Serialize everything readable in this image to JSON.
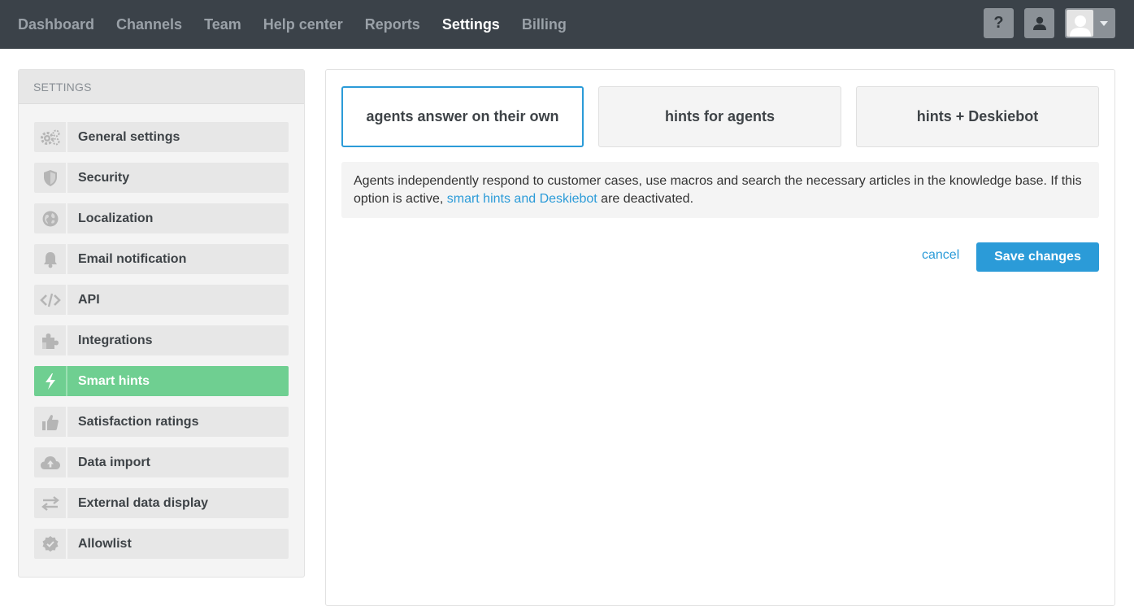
{
  "nav": {
    "items": [
      "Dashboard",
      "Channels",
      "Team",
      "Help center",
      "Reports",
      "Settings",
      "Billing"
    ],
    "active": "Settings",
    "help_label": "?"
  },
  "sidebar": {
    "header": "SETTINGS",
    "items": [
      {
        "label": "General settings",
        "icon": "gears-icon"
      },
      {
        "label": "Security",
        "icon": "shield-icon"
      },
      {
        "label": "Localization",
        "icon": "globe-icon"
      },
      {
        "label": "Email notification",
        "icon": "bell-icon"
      },
      {
        "label": "API",
        "icon": "code-icon"
      },
      {
        "label": "Integrations",
        "icon": "puzzle-icon"
      },
      {
        "label": "Smart hints",
        "icon": "bolt-icon",
        "active": true
      },
      {
        "label": "Satisfaction ratings",
        "icon": "thumbs-up-icon"
      },
      {
        "label": "Data import",
        "icon": "cloud-upload-icon"
      },
      {
        "label": "External data display",
        "icon": "exchange-icon"
      },
      {
        "label": "Allowlist",
        "icon": "badge-check-icon"
      }
    ]
  },
  "main": {
    "options": [
      {
        "label": "agents answer on their own",
        "selected": true
      },
      {
        "label": "hints for agents",
        "selected": false
      },
      {
        "label": "hints + Deskiebot",
        "selected": false
      }
    ],
    "description": {
      "text_before": "Agents independently respond to customer cases, use macros and search the necessary articles in the knowledge base. If this option is active, ",
      "link": "smart hints and Deskiebot",
      "text_after": " are deactivated."
    },
    "cancel_label": "cancel",
    "save_label": "Save changes"
  },
  "colors": {
    "topbar": "#3b4249",
    "accent": "#2b9bd8",
    "active_sidebar": "#6fcf91"
  }
}
